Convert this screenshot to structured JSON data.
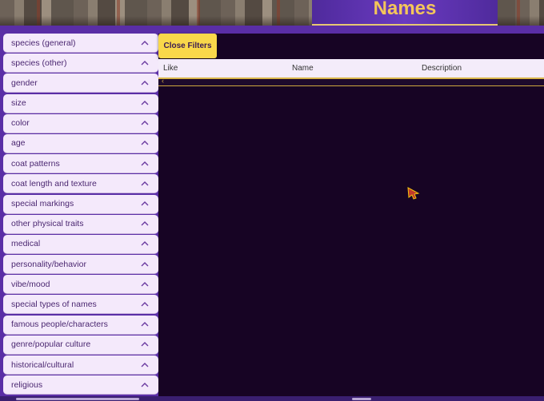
{
  "header": {
    "title": "Names"
  },
  "filters": {
    "items": [
      {
        "label": "species (general)"
      },
      {
        "label": "species (other)"
      },
      {
        "label": "gender"
      },
      {
        "label": "size"
      },
      {
        "label": "color"
      },
      {
        "label": "age"
      },
      {
        "label": "coat patterns"
      },
      {
        "label": "coat length and texture"
      },
      {
        "label": "special markings"
      },
      {
        "label": "other physical traits"
      },
      {
        "label": "medical"
      },
      {
        "label": "personality/behavior"
      },
      {
        "label": "vibe/mood"
      },
      {
        "label": "special types of names"
      },
      {
        "label": "famous people/characters"
      },
      {
        "label": "genre/popular culture"
      },
      {
        "label": "historical/cultural"
      },
      {
        "label": "religious"
      }
    ]
  },
  "main": {
    "close_filters_label": "Close Filters",
    "columns": [
      "Like",
      "Name",
      "Description"
    ],
    "scroll_left_glyph": "‹"
  },
  "colors": {
    "accent_purple": "#5a2ea6",
    "title_gold": "#f4c65a",
    "button_yellow": "#f9d84a",
    "panel_dark": "#170424",
    "filter_bg": "#f4e9fb"
  },
  "icons": {
    "filter_toggle": "chevron-up-icon",
    "cursor": "mouse-pointer-icon"
  }
}
